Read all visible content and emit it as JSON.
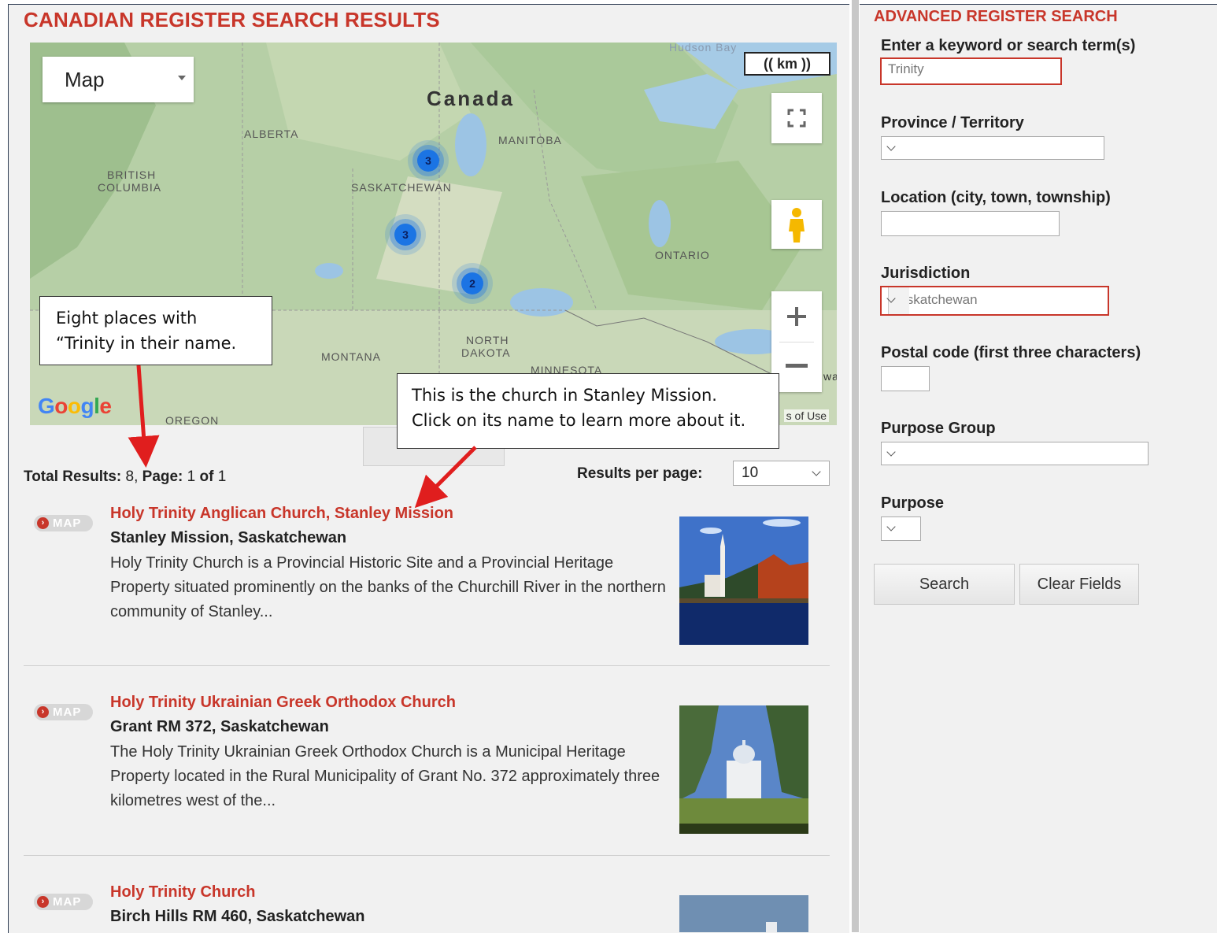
{
  "page": {
    "title": "CANADIAN REGISTER SEARCH RESULTS"
  },
  "map": {
    "type_label": "Map",
    "scale_label": "(( km ))",
    "labels": {
      "canada": "Canada",
      "alberta": "ALBERTA",
      "manitoba": "MANITOBA",
      "british_columbia_1": "BRITISH",
      "british_columbia_2": "COLUMBIA",
      "saskatchewan": "SASKATCHEWAN",
      "ontario": "ONTARIO",
      "montana": "MONTANA",
      "north_dakota_1": "NORTH",
      "north_dakota_2": "DAKOTA",
      "minnesota": "MINNESOTA",
      "hudson_bay": "Hudson Bay",
      "oregon": "OREGON",
      "partial_wa": "wa"
    },
    "clusters": [
      "3",
      "3",
      "2"
    ],
    "google": "Google",
    "terms": "s of Use"
  },
  "callouts": {
    "eight_places": {
      "line1": "Eight places with",
      "line2": "“Trinity in their name."
    },
    "stanley": {
      "line1": "This is the church in Stanley Mission.",
      "line2": "Click on its name to learn more about it."
    }
  },
  "results_meta": {
    "total_label": "Total Results:",
    "total_value": "8",
    "page_label": "Page:",
    "page_value": "1",
    "of_label": "of",
    "of_value": "1",
    "per_page_label": "Results per page:",
    "per_page_value": "10"
  },
  "results": [
    {
      "map_tag": "MAP",
      "title": "Holy Trinity Anglican Church, Stanley Mission",
      "location": "Stanley Mission, Saskatchewan",
      "description": "Holy Trinity Church is a Provincial Historic Site and a Provincial Heritage Property situated prominently on the banks of the Churchill River in the northern community of Stanley..."
    },
    {
      "map_tag": "MAP",
      "title": "Holy Trinity Ukrainian Greek Orthodox Church",
      "location": "Grant RM 372, Saskatchewan",
      "description": "The Holy Trinity Ukrainian Greek Orthodox Church is a Municipal Heritage Property located in the Rural Municipality of Grant No. 372 approximately three kilometres west of the..."
    },
    {
      "map_tag": "MAP",
      "title": "Holy Trinity Church",
      "location": "Birch Hills RM 460, Saskatchewan",
      "description": ""
    }
  ],
  "sidebar": {
    "heading": "ADVANCED REGISTER SEARCH",
    "keyword_label": "Enter a keyword or search term(s)",
    "keyword_value": "Trinity",
    "province_label": "Province / Territory",
    "province_value": "",
    "location_label": "Location (city, town, township)",
    "location_value": "",
    "jurisdiction_label": "Jurisdiction",
    "jurisdiction_value": "Saskatchewan",
    "postal_label": "Postal code (first three characters)",
    "postal_value": "",
    "purpose_group_label": "Purpose Group",
    "purpose_group_value": "",
    "purpose_label": "Purpose",
    "purpose_value": "",
    "search_button": "Search",
    "clear_button": "Clear Fields"
  },
  "colors": {
    "accent_red": "#c8362a",
    "cluster_blue": "#1b74e4",
    "panel_bg": "#f1f1f1"
  }
}
